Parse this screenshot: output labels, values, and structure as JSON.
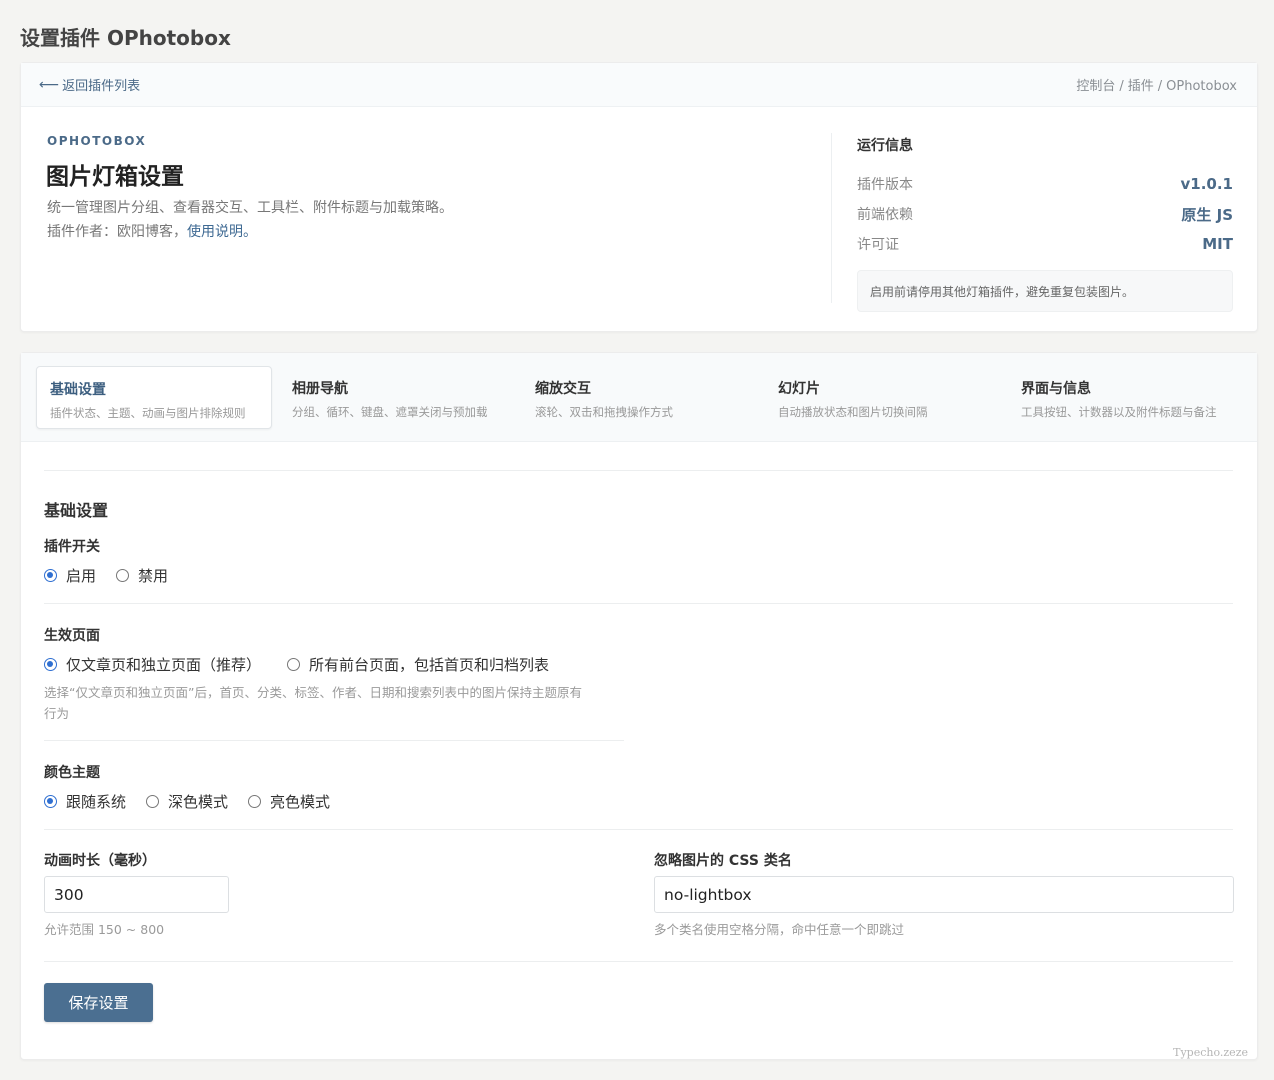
{
  "page": {
    "title": "设置插件 OPhotobox"
  },
  "topbar": {
    "back_label": "返回插件列表",
    "breadcrumb": [
      "控制台",
      "插件",
      "OPhotobox"
    ]
  },
  "plugin": {
    "eyebrow": "OPHOTOBOX",
    "heading": "图片灯箱设置",
    "description": "统一管理图片分组、查看器交互、工具栏、附件标题与加载策略。",
    "author_prefix": "插件作者：欧阳博客，",
    "author_link": "使用说明。"
  },
  "runtime": {
    "title": "运行信息",
    "rows": [
      {
        "key": "插件版本",
        "value": "v1.0.1"
      },
      {
        "key": "前端依赖",
        "value": "原生 JS"
      },
      {
        "key": "许可证",
        "value": "MIT"
      }
    ],
    "notice": "启用前请停用其他灯箱插件，避免重复包装图片。"
  },
  "tabs": [
    {
      "label": "基础设置",
      "sub": "插件状态、主题、动画与图片排除规则",
      "active": true
    },
    {
      "label": "相册导航",
      "sub": "分组、循环、键盘、遮罩关闭与预加载",
      "active": false
    },
    {
      "label": "缩放交互",
      "sub": "滚轮、双击和拖拽操作方式",
      "active": false
    },
    {
      "label": "幻灯片",
      "sub": "自动播放状态和图片切换间隔",
      "active": false
    },
    {
      "label": "界面与信息",
      "sub": "工具按钮、计数器以及附件标题与备注",
      "active": false
    }
  ],
  "form": {
    "section_title": "基础设置",
    "switch": {
      "label": "插件开关",
      "options": [
        "启用",
        "禁用"
      ],
      "selected": 0
    },
    "scope": {
      "label": "生效页面",
      "options": [
        "仅文章页和独立页面（推荐）",
        "所有前台页面，包括首页和归档列表"
      ],
      "selected": 0,
      "hint_line1": "选择“仅文章页和独立页面”后，首页、分类、标签、作者、日期和搜索列表中的图片保持主题原有",
      "hint_line2": "行为"
    },
    "theme": {
      "label": "颜色主题",
      "options": [
        "跟随系统",
        "深色模式",
        "亮色模式"
      ],
      "selected": 0
    },
    "duration": {
      "label": "动画时长（毫秒）",
      "value": "300",
      "hint": "允许范围 150 ~ 800"
    },
    "ignore_class": {
      "label": "忽略图片的 CSS 类名",
      "value": "no-lightbox",
      "hint": "多个类名使用空格分隔，命中任意一个即跳过"
    },
    "save_label": "保存设置"
  },
  "footer": {
    "brand": "Typecho.zeze"
  },
  "colors": {
    "accent": "#4b6f91",
    "radio": "#2f6fd1",
    "link": "#3f6a93"
  }
}
